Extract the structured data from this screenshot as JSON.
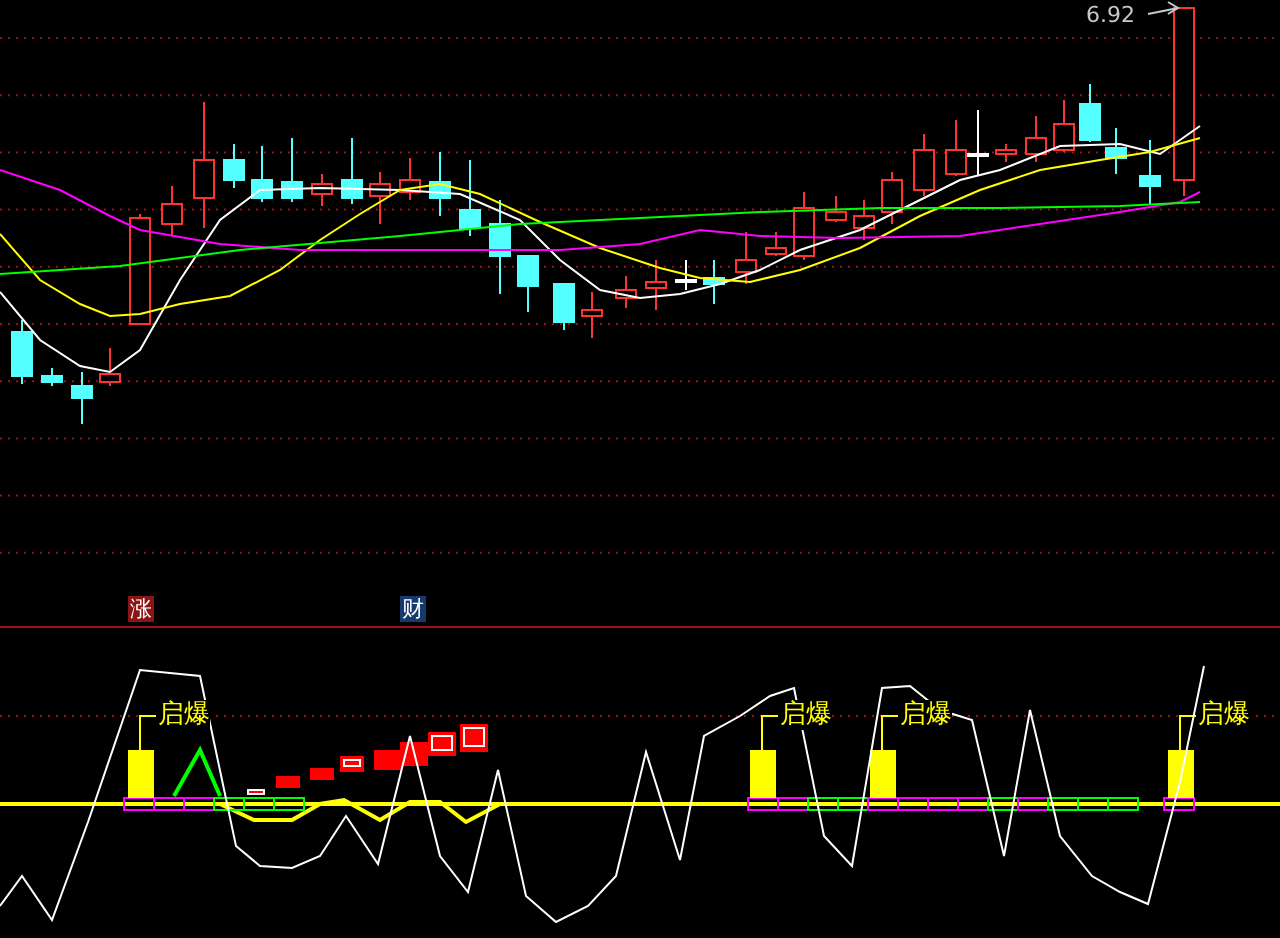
{
  "price_panel": {
    "last_price_label": "6.92"
  },
  "markers": [
    {
      "label": "涨",
      "color": "#8b1414"
    },
    {
      "label": "财",
      "color": "#163a6e"
    }
  ],
  "indicator_panel": {
    "signals": [
      {
        "label": "启爆"
      },
      {
        "label": "启爆"
      },
      {
        "label": "启爆"
      },
      {
        "label": "启爆"
      }
    ]
  }
}
